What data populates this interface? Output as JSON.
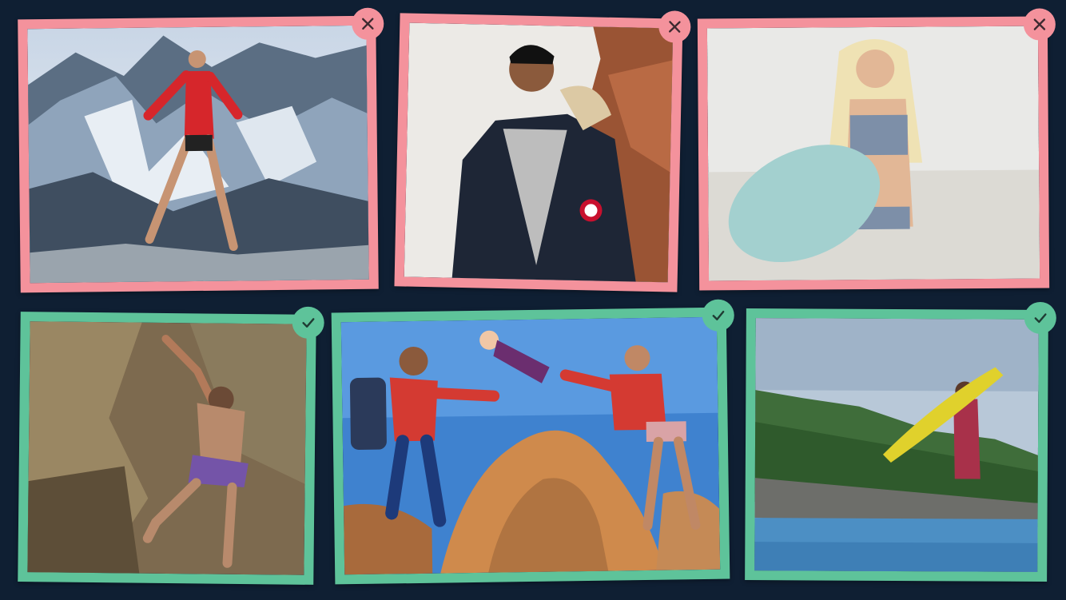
{
  "grid": {
    "rejected": [
      {
        "id": "photo-1",
        "subject": "trail-runner-mountains",
        "status": "rejected",
        "badge_icon": "close-icon"
      },
      {
        "id": "photo-2",
        "subject": "man-parka-canyon",
        "status": "rejected",
        "badge_icon": "close-icon"
      },
      {
        "id": "photo-3",
        "subject": "surfer-beach-board",
        "status": "rejected",
        "badge_icon": "close-icon"
      }
    ],
    "accepted": [
      {
        "id": "photo-4",
        "subject": "rock-climber",
        "status": "accepted",
        "badge_icon": "check-icon"
      },
      {
        "id": "photo-5",
        "subject": "baby-toss-rocks",
        "status": "accepted",
        "badge_icon": "check-icon"
      },
      {
        "id": "photo-6",
        "subject": "surfer-boat",
        "status": "accepted",
        "badge_icon": "check-icon"
      }
    ]
  },
  "colors": {
    "background": "#0f1f33",
    "rejected": "#f4929c",
    "accepted": "#5ec39a",
    "badge_glyph": "#3d2a30"
  }
}
